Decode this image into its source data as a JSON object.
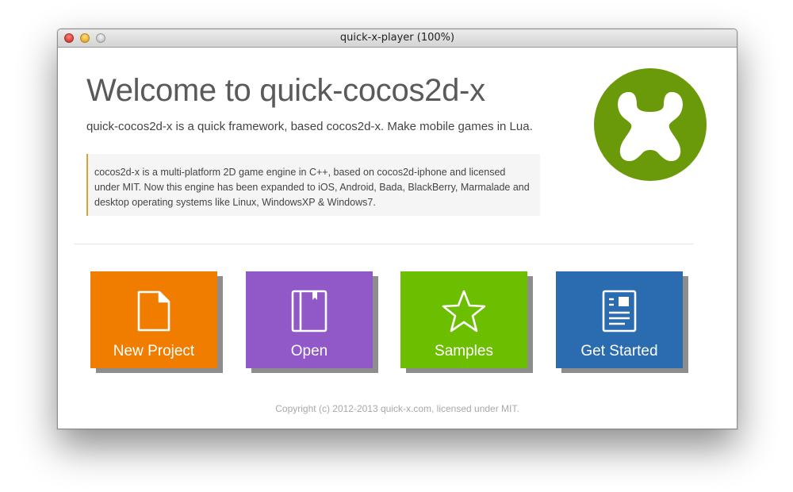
{
  "window": {
    "title": "quick-x-player (100%)"
  },
  "welcome": {
    "heading": "Welcome to quick-cocos2d-x",
    "subtitle": "quick-cocos2d-x is a quick framework, based cocos2d-x. Make mobile games in Lua.",
    "description": "cocos2d-x is a multi-platform 2D game engine in C++, based on cocos2d-iphone and licensed under MIT. Now this engine has been expanded to iOS, Android, Bada, BlackBerry, Marmalade and desktop operating systems like Linux, WindowsXP & Windows7."
  },
  "logo": {
    "icon": "quick-x-logo",
    "color": "#6a9a0a"
  },
  "tiles": [
    {
      "label": "New Project",
      "icon": "document-icon",
      "color": "#f07c00"
    },
    {
      "label": "Open",
      "icon": "book-icon",
      "color": "#9158c8"
    },
    {
      "label": "Samples",
      "icon": "star-icon",
      "color": "#6cbf00"
    },
    {
      "label": "Get Started",
      "icon": "article-icon",
      "color": "#2b6cb0"
    }
  ],
  "footer": {
    "copyright": "Copyright (c) 2012-2013 quick-x.com, licensed under MIT."
  }
}
